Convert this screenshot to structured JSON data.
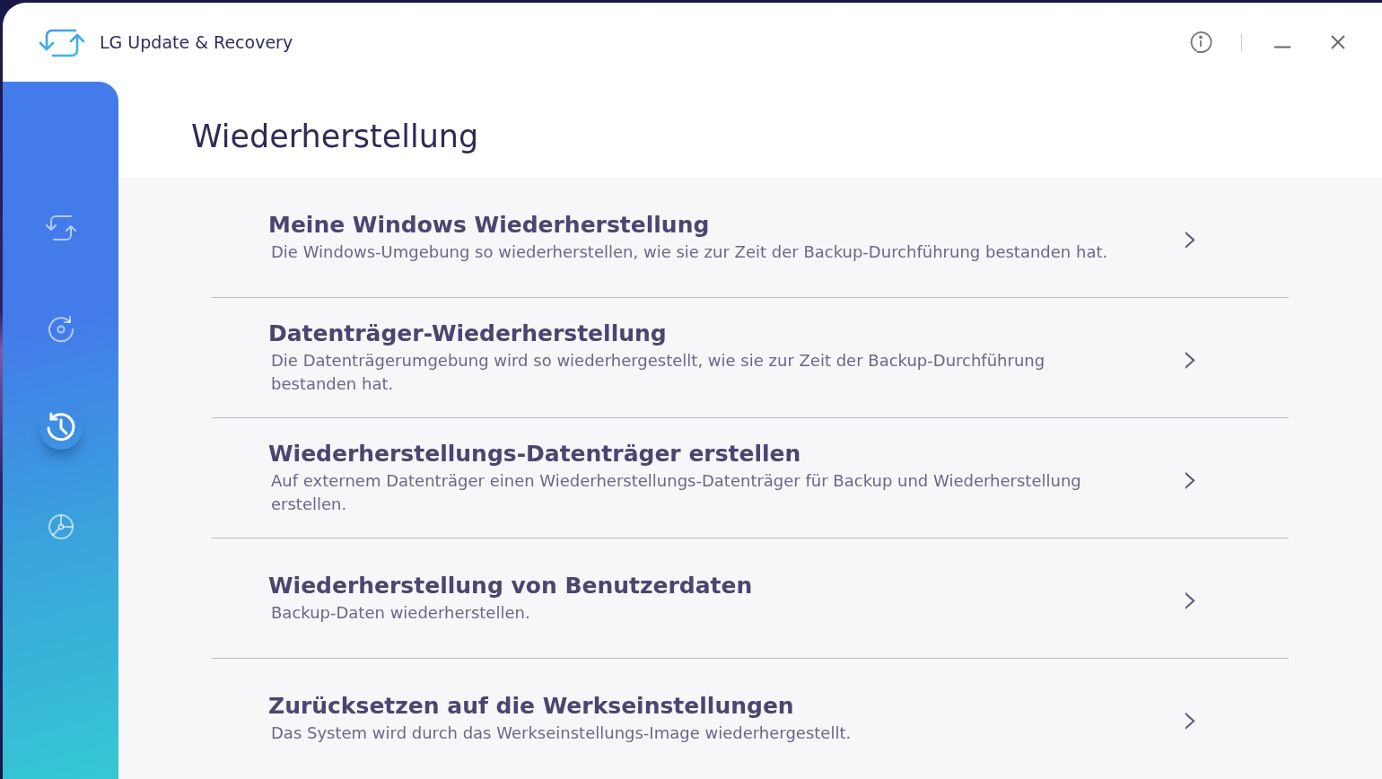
{
  "window": {
    "title": "LG Update & Recovery"
  },
  "sidebar": {
    "items": [
      {
        "selected": false
      },
      {
        "selected": false
      },
      {
        "selected": true
      },
      {
        "selected": false
      }
    ]
  },
  "page": {
    "heading": "Wiederherstellung"
  },
  "options": [
    {
      "title": "Meine Windows Wiederherstellung",
      "description": "Die Windows-Umgebung so wiederherstellen, wie sie zur Zeit der Backup-Durchführung bestanden hat.",
      "chevron": "›"
    },
    {
      "title": "Datenträger-Wiederherstellung",
      "description": "Die Datenträgerumgebung wird so wiederhergestellt, wie sie zur Zeit der Backup-Durchführung bestanden hat.",
      "chevron": "›"
    },
    {
      "title": "Wiederherstellungs-Datenträger erstellen",
      "description": "Auf externem Datenträger einen Wiederherstellungs-Datenträger für Backup und Wiederherstellung erstellen.",
      "chevron": "›"
    },
    {
      "title": "Wiederherstellung von Benutzerdaten",
      "description": "Backup-Daten wiederherstellen.",
      "chevron": "›"
    },
    {
      "title": "Zurücksetzen auf die Werkseinstellungen",
      "description": "Das System wird durch das Werkseinstellungs-Image wiederhergestellt.",
      "chevron": "›"
    }
  ]
}
